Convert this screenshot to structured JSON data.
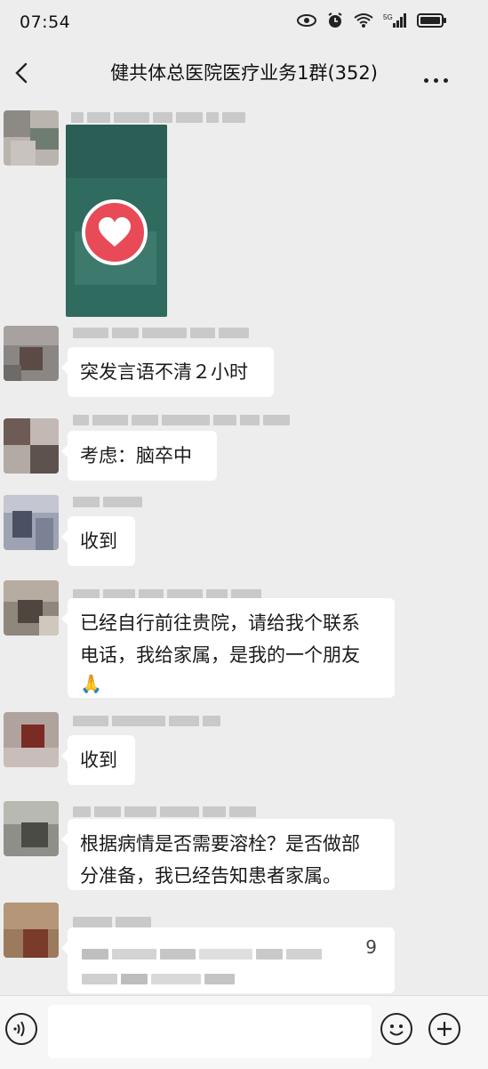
{
  "status": {
    "time": "07:54",
    "icons": [
      "eye-icon",
      "alarm-icon",
      "wifi-icon",
      "5g-signal-icon",
      "battery-icon"
    ]
  },
  "chat": {
    "back_icon": "chevron-left-icon",
    "title": "健共体总医院医疗业务1群(352)",
    "more_icon": "more-dots-icon"
  },
  "messages": [
    {
      "type": "image",
      "badge_icon": "heart-icon"
    },
    {
      "type": "text",
      "text": "突发言语不清２小时"
    },
    {
      "type": "text",
      "text": "考虑：脑卒中"
    },
    {
      "type": "text",
      "text": "收到"
    },
    {
      "type": "text",
      "line1": "已经自行前往贵院，请给我个联系",
      "line2": "电话，我给家属，是我的一个朋友",
      "emoji": "🙏"
    },
    {
      "type": "text",
      "text": "收到"
    },
    {
      "type": "text",
      "line1": "根据病情是否需要溶栓？是否做部",
      "line2": "分准备，我已经告知患者家属。"
    },
    {
      "type": "text",
      "blurred": true,
      "visible_char": "9"
    }
  ],
  "input_bar": {
    "voice_icon": "voice-icon",
    "placeholder": "",
    "emoji_icon": "emoji-icon",
    "plus_icon": "plus-icon"
  },
  "colors": {
    "background": "#ededed",
    "bubble": "#ffffff",
    "badge": "#e84a57"
  }
}
